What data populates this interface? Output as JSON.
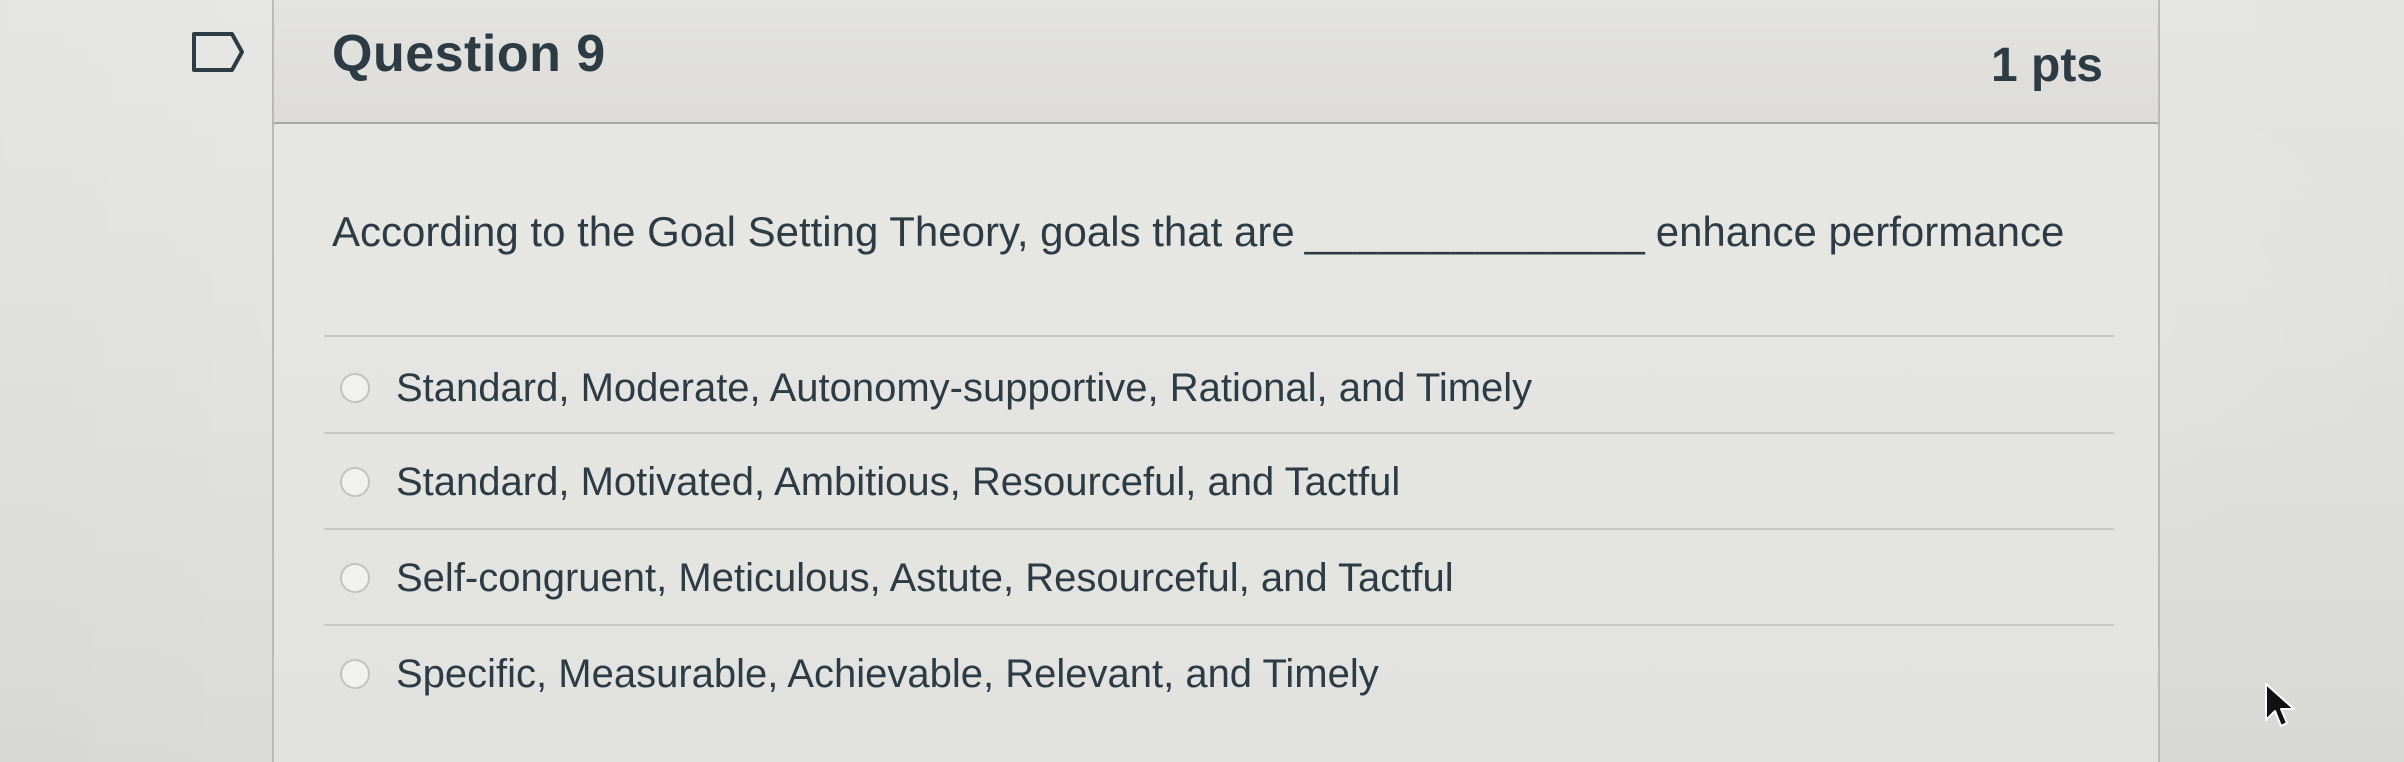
{
  "question": {
    "title": "Question 9",
    "points": "1 pts",
    "text_before": "According to the Goal Setting Theory, goals that are",
    "blank": "______________",
    "text_after": "enhance performance"
  },
  "answers": [
    "Standard, Moderate, Autonomy-supportive, Rational, and Timely",
    "Standard, Motivated, Ambitious, Resourceful, and Tactful",
    "Self-congruent, Meticulous, Astute, Resourceful, and Tactful",
    "Specific, Measurable, Achievable, Relevant, and Timely"
  ],
  "icons": {
    "flag": "flag-icon",
    "radio": "radio-icon",
    "cursor": "cursor-icon"
  },
  "colors": {
    "text": "#2d3b45",
    "divider": "#c7c7c4",
    "border": "#a9a9a6",
    "background": "#e5e5e2"
  }
}
